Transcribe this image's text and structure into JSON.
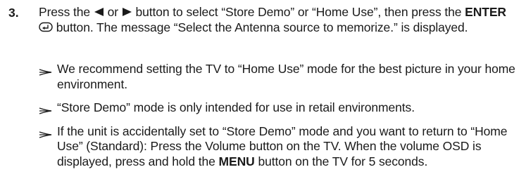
{
  "step": {
    "number": "3.",
    "text_1": "Press the",
    "text_2": "or",
    "text_3": "button to select “Store Demo” or “Home Use”, then press the",
    "enter_label": "ENTER",
    "text_4": "button. The message “Select the Antenna source to memorize.” is displayed."
  },
  "notes": [
    {
      "text": "We recommend setting the TV to “Home Use” mode for the best picture in your home environment."
    },
    {
      "text": "“Store Demo” mode is only intended for use in retail environments."
    },
    {
      "text_1": "If the unit is accidentally set to “Store Demo” mode and you want to return to “Home Use” (Standard): Press the Volume button on the TV. When the volume OSD is displayed, press and hold the",
      "menu_label": "MENU",
      "text_2": "button on the TV for 5 seconds."
    }
  ],
  "icons": {
    "left_arrow": "left-triangle-icon",
    "right_arrow": "right-triangle-icon",
    "enter": "enter-icon",
    "note_arrow": "note-arrow-icon"
  }
}
